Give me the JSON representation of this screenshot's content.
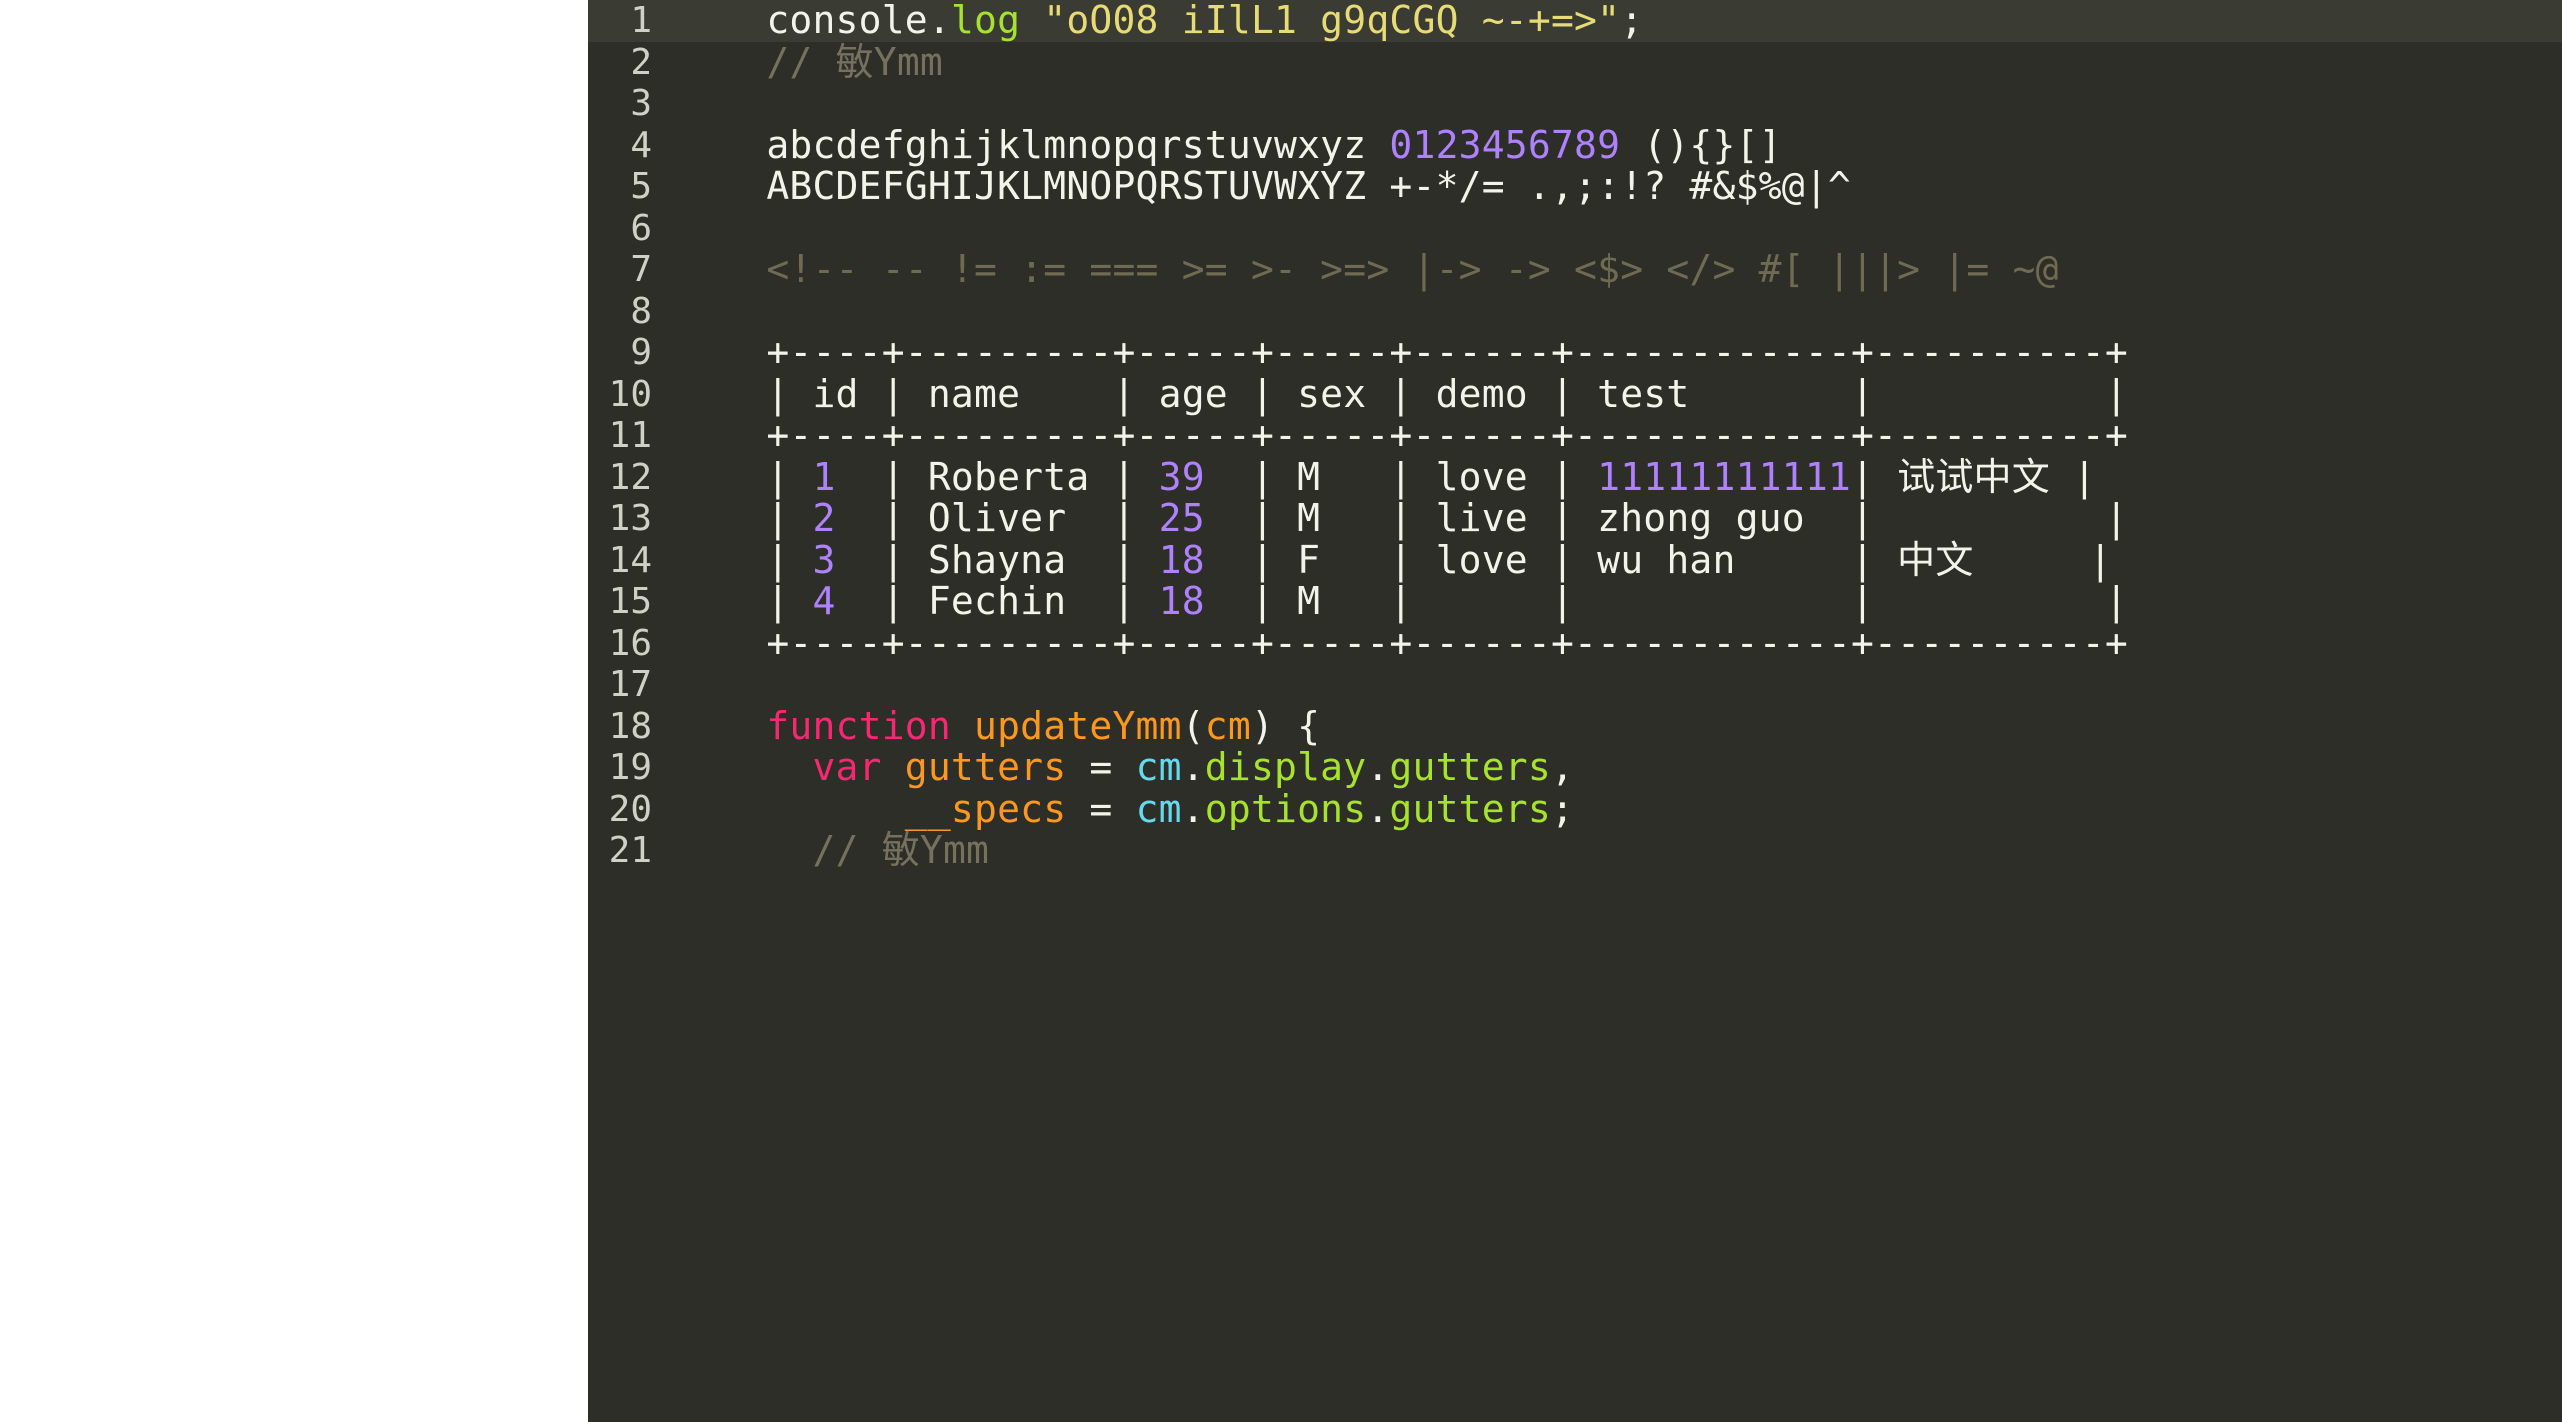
{
  "editor": {
    "theme_name": "monokai-dark",
    "background": "#2c2e27",
    "active_line_background": "#3a3c34",
    "gutter_text_color": "#cfd0c8",
    "default_text_color": "#f2f3ea",
    "font_family_label": "monospace",
    "colors": {
      "keyword": "#f92672",
      "function": "#fd971f",
      "variable": "#fd971f",
      "property": "#a6e22e",
      "parameter": "#66d9ef",
      "string": "#e6db74",
      "number": "#ae81ff",
      "comment": "#75715e",
      "operator": "#f2f3ea",
      "method": "#a6e22e",
      "ligature_muted": "#6e6b52"
    },
    "active_line": 1,
    "first_visible_line": 1,
    "last_visible_line": 21,
    "lines": [
      {
        "number": "1",
        "active": true,
        "tokens": [
          {
            "text": "    ",
            "type": "plain"
          },
          {
            "text": "console",
            "type": "plain"
          },
          {
            "text": ".",
            "type": "plain"
          },
          {
            "text": "log",
            "type": "method"
          },
          {
            "text": " ",
            "type": "plain"
          },
          {
            "text": "\"oO08 iIlL1 g9qCGQ ~-+=>\"",
            "type": "string"
          },
          {
            "text": ";",
            "type": "punct"
          }
        ]
      },
      {
        "number": "2",
        "active": false,
        "tokens": [
          {
            "text": "    ",
            "type": "plain"
          },
          {
            "text": "// 敏Ymm",
            "type": "comment"
          }
        ]
      },
      {
        "number": "3",
        "active": false,
        "tokens": []
      },
      {
        "number": "4",
        "active": false,
        "tokens": [
          {
            "text": "    ",
            "type": "plain"
          },
          {
            "text": "abcdefghijklmnopqrstuvwxyz",
            "type": "plain"
          },
          {
            "text": " ",
            "type": "plain"
          },
          {
            "text": "0123456789",
            "type": "number"
          },
          {
            "text": " (){}[]",
            "type": "plain"
          }
        ]
      },
      {
        "number": "5",
        "active": false,
        "tokens": [
          {
            "text": "    ",
            "type": "plain"
          },
          {
            "text": "ABCDEFGHIJKLMNOPQRSTUVWXYZ +-*/= .,;:!? #&$%@|^",
            "type": "plain"
          }
        ]
      },
      {
        "number": "6",
        "active": false,
        "tokens": []
      },
      {
        "number": "7",
        "active": false,
        "tokens": [
          {
            "text": "    ",
            "type": "plain"
          },
          {
            "text": "<!-- -- != := === >= >- >=> |-> -> <$> </> #[ |||> |= ~@",
            "type": "muted"
          }
        ]
      },
      {
        "number": "8",
        "active": false,
        "tokens": []
      },
      {
        "number": "9",
        "active": false,
        "tokens": [
          {
            "text": "    ",
            "type": "plain"
          },
          {
            "text": "+----+---------+-----+-----+------+------------+----------+",
            "type": "plain"
          }
        ]
      },
      {
        "number": "10",
        "active": false,
        "tokens": [
          {
            "text": "    ",
            "type": "plain"
          },
          {
            "text": "| id | name    | age | sex | demo | test       |          |",
            "type": "plain"
          }
        ]
      },
      {
        "number": "11",
        "active": false,
        "tokens": [
          {
            "text": "    ",
            "type": "plain"
          },
          {
            "text": "+----+---------+-----+-----+------+------------+----------+",
            "type": "plain"
          }
        ]
      },
      {
        "number": "12",
        "active": false,
        "tokens": [
          {
            "text": "    ",
            "type": "plain"
          },
          {
            "text": "| ",
            "type": "plain"
          },
          {
            "text": "1",
            "type": "number"
          },
          {
            "text": "  | Roberta | ",
            "type": "plain"
          },
          {
            "text": "39",
            "type": "number"
          },
          {
            "text": "  | M   | love | ",
            "type": "plain"
          },
          {
            "text": "11111111111",
            "type": "number"
          },
          {
            "text": "| 试试中文 |",
            "type": "plain"
          }
        ]
      },
      {
        "number": "13",
        "active": false,
        "tokens": [
          {
            "text": "    ",
            "type": "plain"
          },
          {
            "text": "| ",
            "type": "plain"
          },
          {
            "text": "2",
            "type": "number"
          },
          {
            "text": "  | Oliver  | ",
            "type": "plain"
          },
          {
            "text": "25",
            "type": "number"
          },
          {
            "text": "  | M   | live | zhong guo  |          |",
            "type": "plain"
          }
        ]
      },
      {
        "number": "14",
        "active": false,
        "tokens": [
          {
            "text": "    ",
            "type": "plain"
          },
          {
            "text": "| ",
            "type": "plain"
          },
          {
            "text": "3",
            "type": "number"
          },
          {
            "text": "  | Shayna  | ",
            "type": "plain"
          },
          {
            "text": "18",
            "type": "number"
          },
          {
            "text": "  | F   | love | wu han     | 中文     |",
            "type": "plain"
          }
        ]
      },
      {
        "number": "15",
        "active": false,
        "tokens": [
          {
            "text": "    ",
            "type": "plain"
          },
          {
            "text": "| ",
            "type": "plain"
          },
          {
            "text": "4",
            "type": "number"
          },
          {
            "text": "  | Fechin  | ",
            "type": "plain"
          },
          {
            "text": "18",
            "type": "number"
          },
          {
            "text": "  | M   |      |            |          |",
            "type": "plain"
          }
        ]
      },
      {
        "number": "16",
        "active": false,
        "tokens": [
          {
            "text": "    ",
            "type": "plain"
          },
          {
            "text": "+----+---------+-----+-----+------+------------+----------+",
            "type": "plain"
          }
        ]
      },
      {
        "number": "17",
        "active": false,
        "tokens": []
      },
      {
        "number": "18",
        "active": false,
        "tokens": [
          {
            "text": "    ",
            "type": "plain"
          },
          {
            "text": "function",
            "type": "keyword"
          },
          {
            "text": " ",
            "type": "plain"
          },
          {
            "text": "updateYmm",
            "type": "func"
          },
          {
            "text": "(",
            "type": "punct"
          },
          {
            "text": "cm",
            "type": "var"
          },
          {
            "text": ") {",
            "type": "punct"
          }
        ]
      },
      {
        "number": "19",
        "active": false,
        "tokens": [
          {
            "text": "      ",
            "type": "plain"
          },
          {
            "text": "var",
            "type": "keyword"
          },
          {
            "text": " ",
            "type": "plain"
          },
          {
            "text": "gutters",
            "type": "var"
          },
          {
            "text": " = ",
            "type": "op"
          },
          {
            "text": "cm",
            "type": "param"
          },
          {
            "text": ".",
            "type": "punct"
          },
          {
            "text": "display",
            "type": "prop"
          },
          {
            "text": ".",
            "type": "punct"
          },
          {
            "text": "gutters",
            "type": "prop"
          },
          {
            "text": ",",
            "type": "punct"
          }
        ]
      },
      {
        "number": "20",
        "active": false,
        "tokens": [
          {
            "text": "          ",
            "type": "plain"
          },
          {
            "text": "__specs",
            "type": "var"
          },
          {
            "text": " = ",
            "type": "op"
          },
          {
            "text": "cm",
            "type": "param"
          },
          {
            "text": ".",
            "type": "punct"
          },
          {
            "text": "options",
            "type": "prop"
          },
          {
            "text": ".",
            "type": "punct"
          },
          {
            "text": "gutters",
            "type": "prop"
          },
          {
            "text": ";",
            "type": "punct"
          }
        ]
      },
      {
        "number": "21",
        "active": false,
        "tokens": [
          {
            "text": "      ",
            "type": "plain"
          },
          {
            "text": "// 敏Ymm",
            "type": "comment"
          }
        ]
      }
    ]
  },
  "sample_table": {
    "columns": [
      "id",
      "name",
      "age",
      "sex",
      "demo",
      "test",
      ""
    ],
    "rows": [
      [
        "1",
        "Roberta",
        "39",
        "M",
        "love",
        "11111111111",
        "试试中文"
      ],
      [
        "2",
        "Oliver",
        "25",
        "M",
        "live",
        "zhong guo",
        ""
      ],
      [
        "3",
        "Shayna",
        "18",
        "F",
        "love",
        "wu han",
        "中文"
      ],
      [
        "4",
        "Fechin",
        "18",
        "M",
        "",
        "",
        ""
      ]
    ]
  },
  "specimen": {
    "lowercase": "abcdefghijklmnopqrstuvwxyz",
    "uppercase": "ABCDEFGHIJKLMNOPQRSTUVWXYZ",
    "digits": "0123456789",
    "brackets": "(){}[]",
    "math_ops": "+-*/=",
    "punctuation": ".,;:!?",
    "symbols": "#&$%@|^",
    "ligatures": "<!-- -- != := === >= >- >=> |-> -> <$> </> #[ |||> |= ~@",
    "ambiguous_glyphs": "oO08 iIlL1 g9qCGQ ~-+=>"
  }
}
